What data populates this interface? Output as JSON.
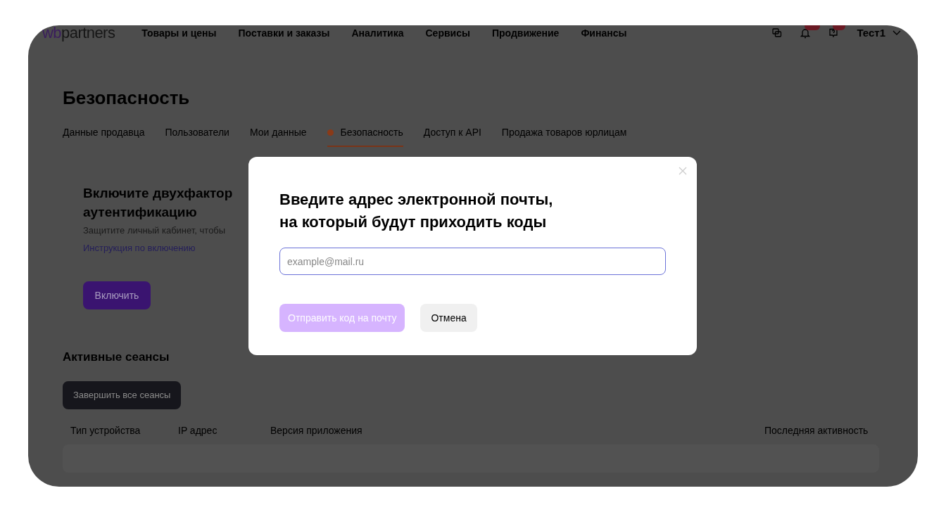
{
  "header": {
    "logo_prefix": "wb",
    "logo_suffix": "partners",
    "nav": [
      "Товары и цены",
      "Поставки и заказы",
      "Аналитика",
      "Сервисы",
      "Продвижение",
      "Финансы"
    ],
    "user": "Тест1"
  },
  "page": {
    "title": "Безопасность",
    "tabs": [
      {
        "label": "Данные продавца",
        "selected": false,
        "alert": false
      },
      {
        "label": "Пользователи",
        "selected": false,
        "alert": false
      },
      {
        "label": "Мои данные",
        "selected": false,
        "alert": false
      },
      {
        "label": "Безопасность",
        "selected": true,
        "alert": true
      },
      {
        "label": "Доступ к API",
        "selected": false,
        "alert": false
      },
      {
        "label": "Продажа товаров юрлицам",
        "selected": false,
        "alert": false
      }
    ],
    "two_factor_card": {
      "title_lines": [
        "Включите двухфактор",
        "аутентификацию"
      ],
      "text": "Защитите личный кабинет, чтобы",
      "link": "Инструкция по включению",
      "button": "Включить"
    },
    "sessions": {
      "title": "Активные сеансы",
      "button": "Завершить все сеансы",
      "columns": [
        "Тип устройства",
        "IP адрес",
        "Версия приложения",
        "Последняя активность"
      ]
    }
  },
  "modal": {
    "title_lines": [
      "Введите адрес электронной почты,",
      "на который будут приходить коды"
    ],
    "email_field": {
      "placeholder": "example@mail.ru"
    },
    "buttons": [
      {
        "label": "Отправить код на почту",
        "disabled": true
      },
      {
        "label": "Отмена",
        "disabled": false
      }
    ]
  }
}
